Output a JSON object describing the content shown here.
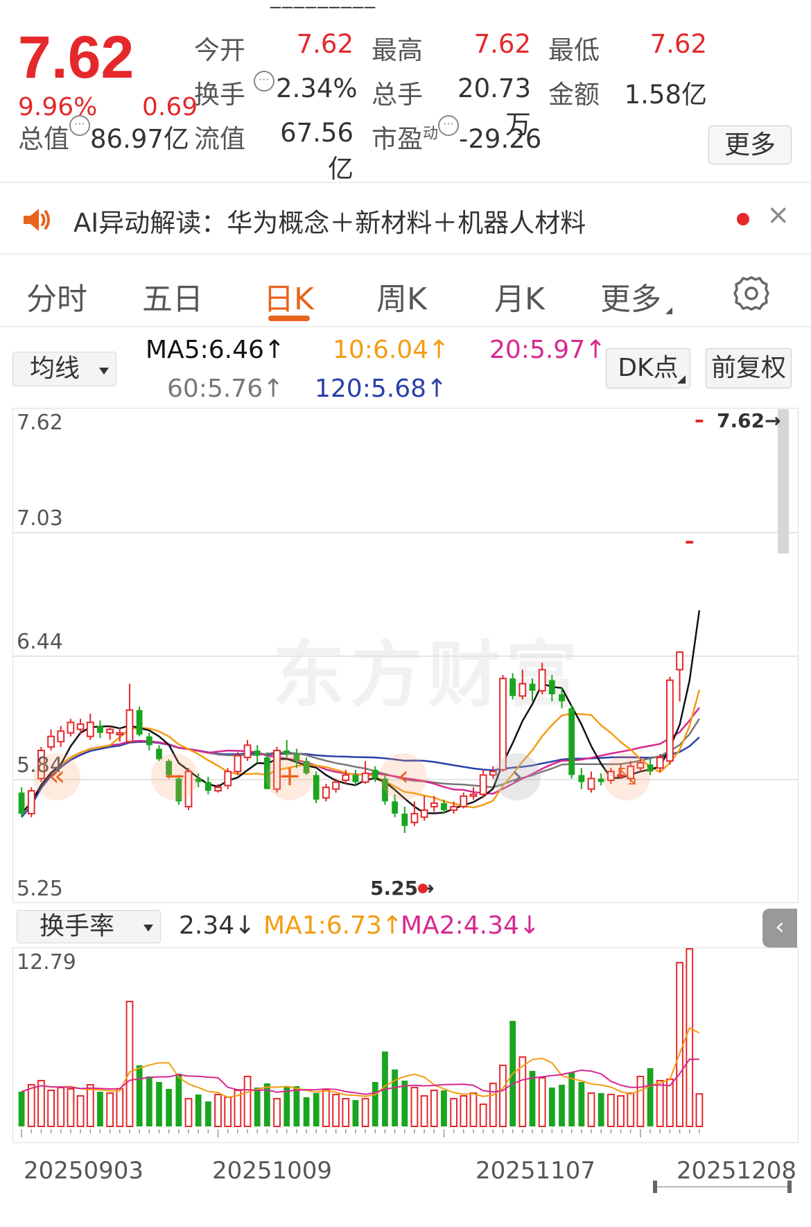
{
  "quote": {
    "price": "7.62",
    "change_pct": "9.96%",
    "change": "0.69",
    "open_label": "今开",
    "open": "7.62",
    "high_label": "最高",
    "high": "7.62",
    "low_label": "最低",
    "low": "7.62",
    "turnover_label": "换手",
    "turnover": "2.34%",
    "volume_label": "总手",
    "volume": "20.73万",
    "amount_label": "金额",
    "amount": "1.58亿",
    "mktcap_label": "总值",
    "mktcap": "86.97亿",
    "float_label": "流值",
    "float_cap": "67.56亿",
    "pe_label": "市盈",
    "pe_sup": "动",
    "pe": "-29.26",
    "more_label": "更多",
    "info_icon": "ellipsis-circle-icon"
  },
  "ai": {
    "text": "AI异动解读：华为概念＋新材料＋机器人材料",
    "icon": "speaker-icon",
    "close": "×"
  },
  "tabs": [
    {
      "label": "分时"
    },
    {
      "label": "五日"
    },
    {
      "label": "日K",
      "active": true
    },
    {
      "label": "周K"
    },
    {
      "label": "月K"
    },
    {
      "label": "更多"
    }
  ],
  "indicators": {
    "selector": "均线",
    "ma5": "MA5:6.46↑",
    "ma10": "10:6.04↑",
    "ma20": "20:5.97↑",
    "ma60": "60:5.76↑",
    "ma120": "120:5.68↑",
    "dk_button": "DK点",
    "adjust_button": "前复权"
  },
  "colors": {
    "up": "#e4282b",
    "down": "#1aa520",
    "ma5": "#111111",
    "ma10": "#f39c12",
    "ma20": "#d6288f",
    "ma60": "#777777",
    "ma120": "#2a3fa8",
    "accent": "#e8631c"
  },
  "main_chart": {
    "y_labels": [
      "7.62",
      "7.03",
      "6.44",
      "5.84",
      "5.25"
    ],
    "last_price_tag": "7.62→",
    "low_tag": "5.25→",
    "watermark": "东方财富"
  },
  "sub_indicator": {
    "selector": "换手率",
    "value": "2.34↓",
    "ma1": "MA1:6.73↑",
    "ma2": "MA2:4.34↓",
    "max_label": "12.79",
    "collapse": "‹"
  },
  "dates": [
    "20250903",
    "20251009",
    "20251107",
    "20251208"
  ],
  "chart_data": {
    "type": "candlestick",
    "ylim": [
      5.25,
      7.62
    ],
    "candles": [
      [
        5.5,
        5.38,
        5.53,
        5.36
      ],
      [
        5.38,
        5.51,
        5.53,
        5.36
      ],
      [
        5.58,
        5.74,
        5.76,
        5.56
      ],
      [
        5.76,
        5.82,
        5.86,
        5.74
      ],
      [
        5.79,
        5.85,
        5.88,
        5.76
      ],
      [
        5.84,
        5.9,
        5.92,
        5.82
      ],
      [
        5.86,
        5.89,
        5.92,
        5.83
      ],
      [
        5.82,
        5.9,
        5.95,
        5.8
      ],
      [
        5.88,
        5.84,
        5.91,
        5.81
      ],
      [
        5.84,
        5.86,
        5.88,
        5.8
      ],
      [
        5.83,
        5.84,
        5.87,
        5.79
      ],
      [
        5.79,
        5.97,
        6.12,
        5.78
      ],
      [
        5.97,
        5.83,
        5.99,
        5.82
      ],
      [
        5.82,
        5.77,
        5.84,
        5.74
      ],
      [
        5.75,
        5.69,
        5.77,
        5.68
      ],
      [
        5.68,
        5.6,
        5.69,
        5.58
      ],
      [
        5.58,
        5.45,
        5.6,
        5.43
      ],
      [
        5.42,
        5.62,
        5.64,
        5.4
      ],
      [
        5.58,
        5.56,
        5.61,
        5.53
      ],
      [
        5.56,
        5.51,
        5.59,
        5.49
      ],
      [
        5.51,
        5.53,
        5.55,
        5.5
      ],
      [
        5.54,
        5.62,
        5.64,
        5.52
      ],
      [
        5.62,
        5.71,
        5.73,
        5.6
      ],
      [
        5.7,
        5.77,
        5.8,
        5.68
      ],
      [
        5.74,
        5.71,
        5.77,
        5.67
      ],
      [
        5.7,
        5.52,
        5.73,
        5.52
      ],
      [
        5.52,
        5.74,
        5.76,
        5.5
      ],
      [
        5.74,
        5.72,
        5.8,
        5.7
      ],
      [
        5.72,
        5.68,
        5.75,
        5.64
      ],
      [
        5.68,
        5.61,
        5.7,
        5.6
      ],
      [
        5.6,
        5.46,
        5.62,
        5.44
      ],
      [
        5.47,
        5.53,
        5.55,
        5.45
      ],
      [
        5.52,
        5.56,
        5.58,
        5.5
      ],
      [
        5.57,
        5.6,
        5.63,
        5.55
      ],
      [
        5.6,
        5.56,
        5.63,
        5.54
      ],
      [
        5.56,
        5.61,
        5.68,
        5.55
      ],
      [
        5.63,
        5.58,
        5.65,
        5.56
      ],
      [
        5.58,
        5.45,
        5.61,
        5.43
      ],
      [
        5.45,
        5.38,
        5.49,
        5.36
      ],
      [
        5.38,
        5.31,
        5.42,
        5.27
      ],
      [
        5.33,
        5.38,
        5.45,
        5.31
      ],
      [
        5.36,
        5.4,
        5.48,
        5.34
      ],
      [
        5.42,
        5.44,
        5.48,
        5.39
      ],
      [
        5.44,
        5.4,
        5.46,
        5.38
      ],
      [
        5.4,
        5.42,
        5.45,
        5.38
      ],
      [
        5.42,
        5.48,
        5.5,
        5.41
      ],
      [
        5.48,
        5.49,
        5.53,
        5.46
      ],
      [
        5.49,
        5.6,
        5.63,
        5.47
      ],
      [
        5.6,
        5.62,
        5.65,
        5.58
      ],
      [
        5.63,
        6.15,
        6.17,
        5.62
      ],
      [
        6.15,
        6.05,
        6.18,
        6.03
      ],
      [
        6.05,
        6.12,
        6.2,
        6.03
      ],
      [
        6.12,
        6.08,
        6.15,
        6.02
      ],
      [
        6.08,
        6.2,
        6.24,
        6.06
      ],
      [
        6.14,
        6.06,
        6.17,
        6.02
      ],
      [
        6.06,
        6.02,
        6.1,
        5.98
      ],
      [
        5.98,
        5.6,
        6.0,
        5.58
      ],
      [
        5.6,
        5.56,
        5.64,
        5.52
      ],
      [
        5.52,
        5.58,
        5.62,
        5.5
      ],
      [
        5.58,
        5.56,
        5.61,
        5.54
      ],
      [
        5.57,
        5.62,
        5.64,
        5.55
      ],
      [
        5.6,
        5.6,
        5.66,
        5.58
      ],
      [
        5.58,
        5.65,
        5.68,
        5.56
      ],
      [
        5.64,
        5.67,
        5.7,
        5.62
      ],
      [
        5.66,
        5.62,
        5.69,
        5.6
      ],
      [
        5.64,
        5.7,
        5.72,
        5.62
      ],
      [
        5.68,
        6.14,
        6.16,
        5.66
      ],
      [
        6.2,
        6.3,
        6.3,
        6.02
      ],
      [
        6.93,
        6.93,
        6.93,
        6.93
      ],
      [
        7.62,
        7.62,
        7.62,
        7.62
      ]
    ],
    "turnover_pct": [
      2.5,
      3.0,
      3.3,
      2.6,
      2.8,
      2.7,
      2.2,
      3.0,
      2.5,
      2.4,
      2.7,
      9.0,
      4.4,
      3.6,
      3.2,
      2.7,
      3.8,
      2.0,
      2.3,
      1.8,
      2.3,
      2.1,
      2.6,
      3.6,
      2.8,
      3.1,
      2.0,
      2.9,
      2.9,
      2.1,
      2.4,
      2.6,
      2.3,
      2.0,
      1.9,
      2.0,
      3.2,
      5.4,
      4.1,
      3.3,
      2.8,
      2.2,
      2.6,
      2.6,
      2.0,
      2.2,
      2.4,
      1.6,
      3.1,
      4.4,
      7.6,
      5.0,
      4.0,
      3.5,
      2.8,
      3.0,
      3.9,
      3.2,
      2.4,
      2.4,
      2.3,
      2.2,
      2.4,
      3.6,
      4.2,
      3.3,
      3.4,
      11.8,
      12.79,
      2.34
    ]
  }
}
